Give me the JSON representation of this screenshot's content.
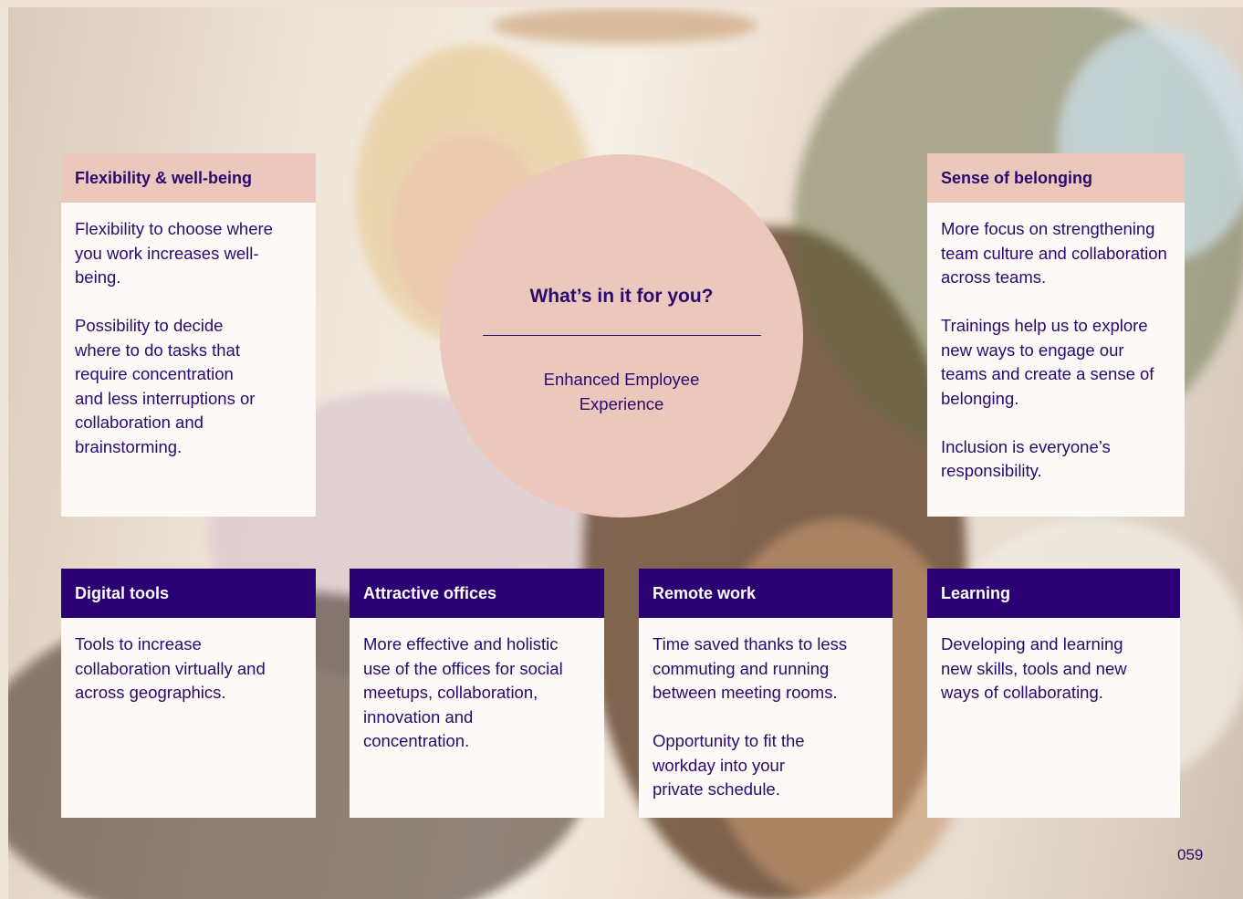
{
  "circle": {
    "title": "What’s in it for you?",
    "subtitle_line1": "Enhanced Employee",
    "subtitle_line2": "Experience"
  },
  "cards": {
    "flexibility": {
      "title": "Flexibility & well-being",
      "paragraphs": [
        "Flexibility to choose where you work increases well-being.",
        "Possibility to decide where to do tasks that require concentration and less interruptions or collaboration and brainstorming."
      ]
    },
    "belonging": {
      "title": "Sense of belonging",
      "paragraphs": [
        "More focus on strengthening team culture and collaboration across teams.",
        "Trainings help us to explore new ways to engage our teams and create a sense of belonging.",
        "Inclusion is everyone’s responsibility."
      ]
    },
    "digital": {
      "title": "Digital tools",
      "paragraphs": [
        "Tools to increase collaboration virtually and across geographics."
      ]
    },
    "offices": {
      "title": "Attractive offices",
      "paragraphs": [
        "More effective and holistic use of the offices for social meetups, collaboration, innovation and concentration."
      ]
    },
    "remote": {
      "title": "Remote work",
      "paragraphs": [
        "Time saved thanks to less commuting and running between meeting rooms.",
        "Opportunity to fit the workday into your private schedule."
      ]
    },
    "learning": {
      "title": "Learning",
      "paragraphs": [
        "Developing and learning new skills, tools and new ways of collaborating."
      ]
    }
  },
  "page_number": "059",
  "colors": {
    "accent_purple": "#2a0072",
    "accent_pink": "#ebc8bb",
    "card_bg": "#fdf9f6"
  }
}
